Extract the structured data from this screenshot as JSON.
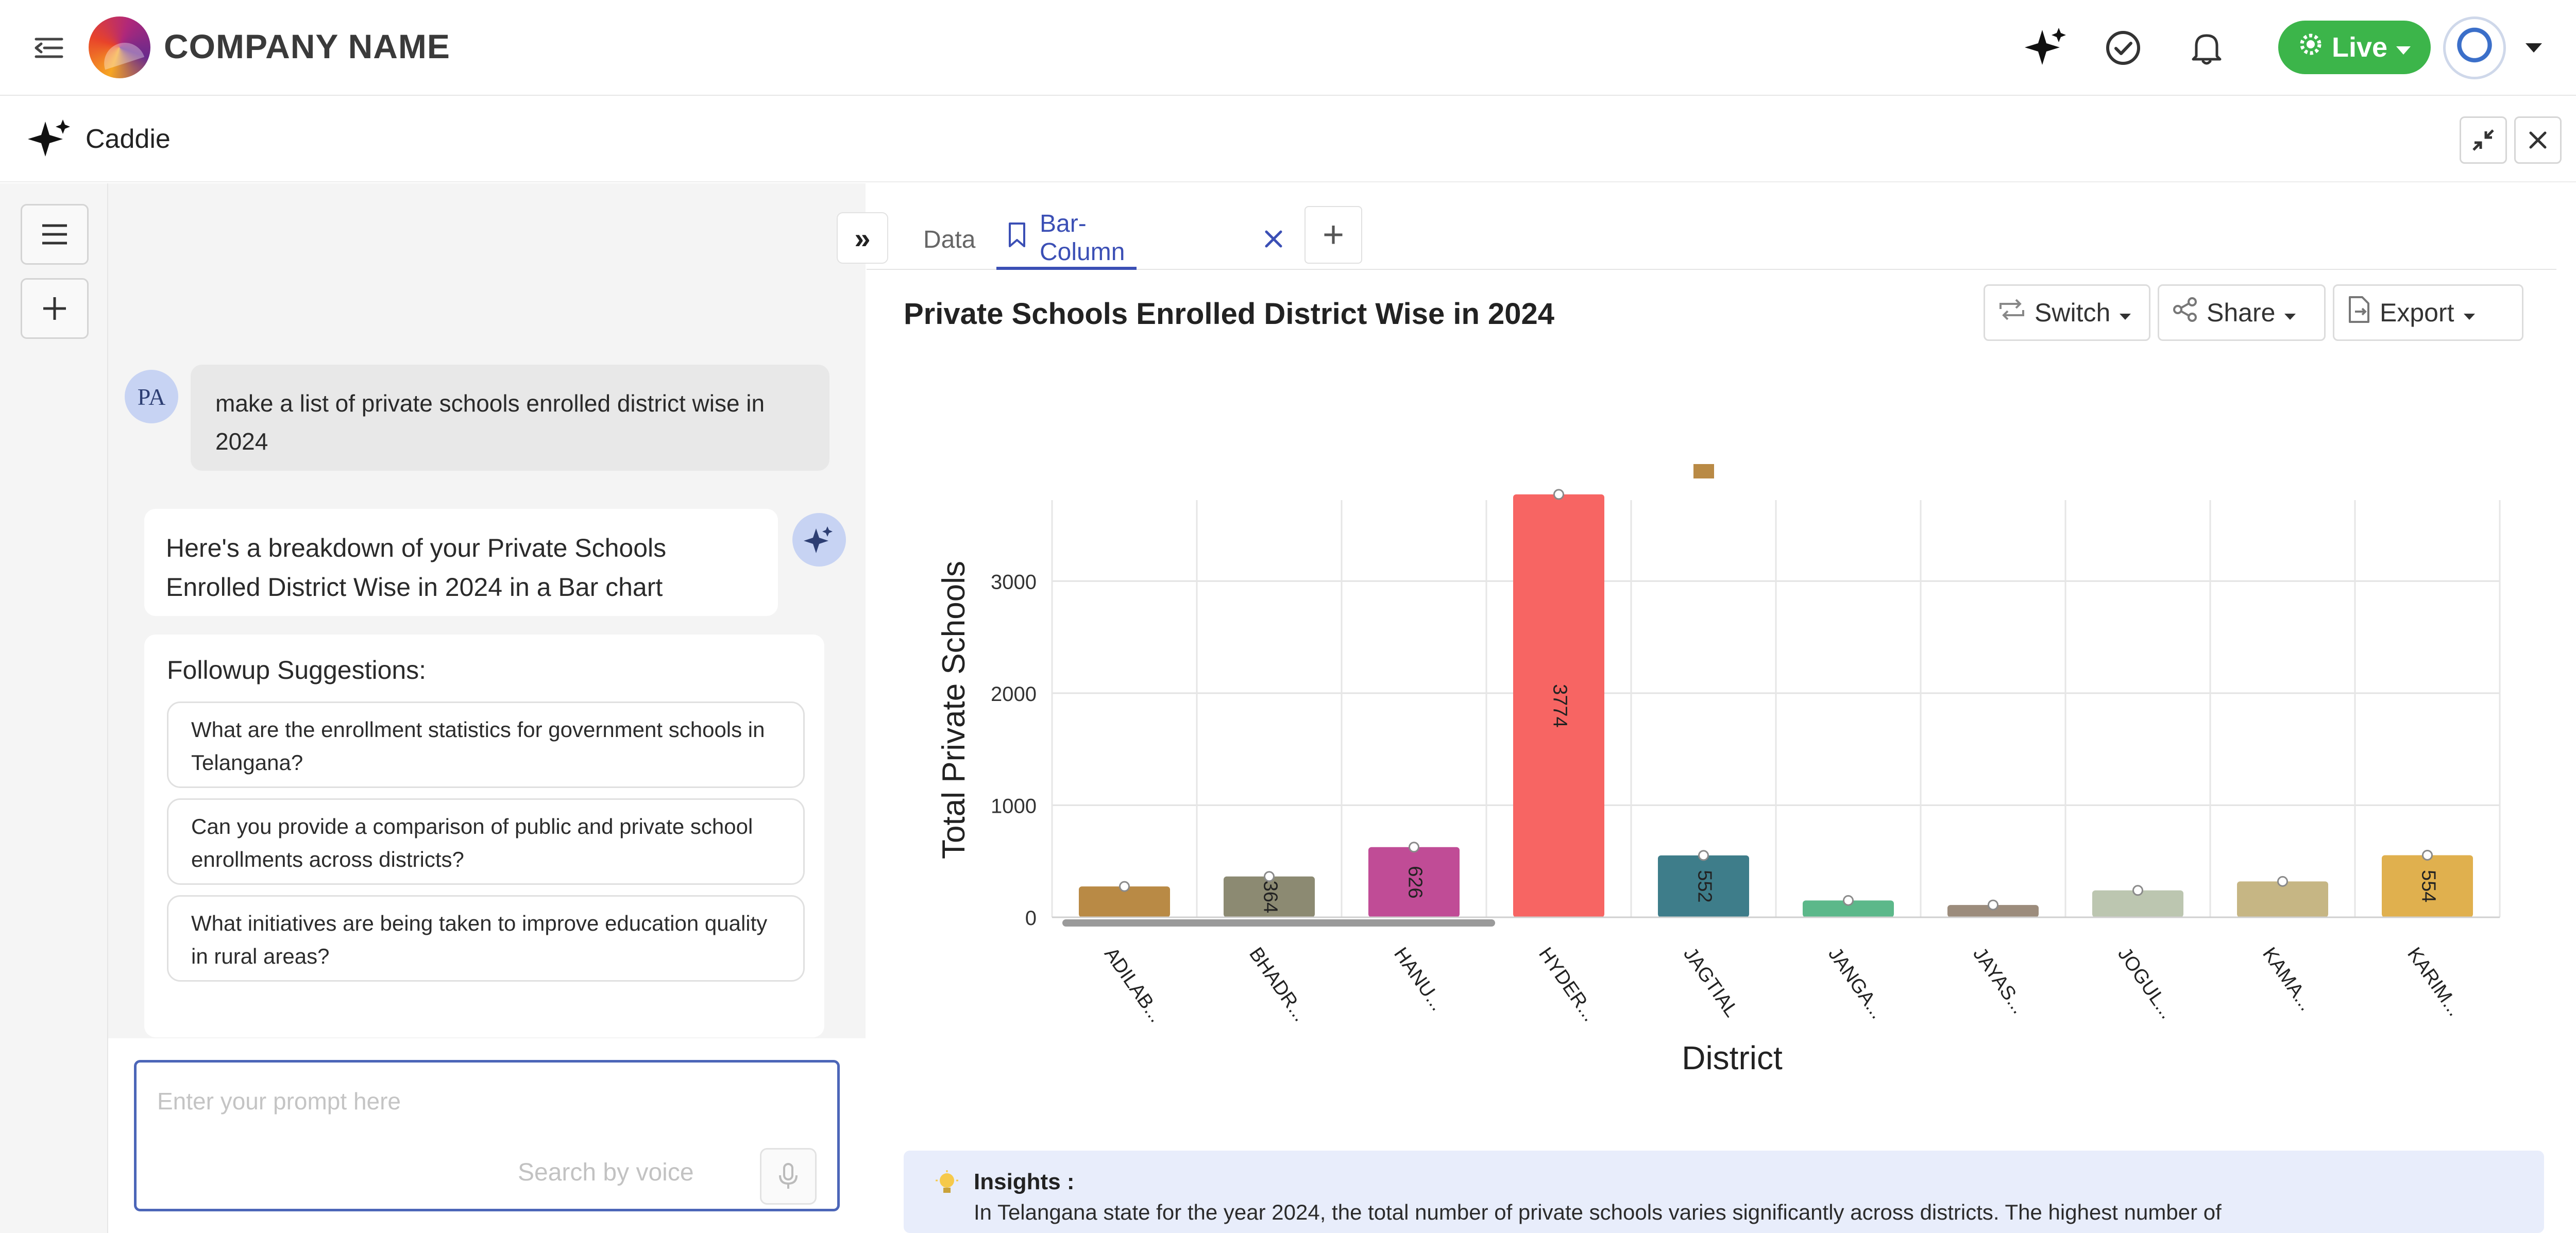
{
  "header": {
    "company_name": "COMPANY NAME",
    "live_label": "Live",
    "icons": [
      "menu-collapse-icon",
      "sparkle-icon",
      "check-circle-icon",
      "bell-icon",
      "gear-icon",
      "user-avatar",
      "caret-down-icon"
    ]
  },
  "caddie": {
    "title": "Caddie",
    "icons": [
      "sparkle-icon",
      "minimize-icon",
      "close-icon"
    ]
  },
  "rail": {
    "icons": [
      "hamburger-icon",
      "plus-icon"
    ]
  },
  "chat": {
    "user_initials": "PA",
    "user_message": "make a list of private schools enrolled district wise in 2024",
    "bot_message": "Here's a breakdown of your Private Schools Enrolled District Wise in 2024 in a Bar chart",
    "followup_title": "Followup Suggestions:",
    "followups": [
      "What are the enrollment statistics for government schools in Telangana?",
      "Can you provide a comparison of public and private school enrollments across districts?",
      "What initiatives are being taken to improve education quality in rural areas?"
    ],
    "prompt_placeholder": "Enter your prompt here",
    "voice_label": "Search by voice"
  },
  "tabs": {
    "data_label": "Data",
    "bar_label": "Bar-Column"
  },
  "toolbar": {
    "switch_label": "Switch",
    "share_label": "Share",
    "export_label": "Export"
  },
  "insights": {
    "title": "Insights :",
    "text": "In Telangana state for the year 2024, the total number of private schools varies significantly across districts. The highest number of"
  },
  "colors": {
    "accent": "#3b4fb5",
    "live": "#3cb54a"
  },
  "chart_data": {
    "type": "bar",
    "title": "Private Schools Enrolled District Wise in 2024",
    "xlabel": "District",
    "ylabel": "Total Private Schools",
    "ylim": [
      0,
      3700
    ],
    "yticks": [
      0,
      1000,
      2000,
      3000
    ],
    "categories": [
      "ADILAB...",
      "BHADR...",
      "HANU...",
      "HYDER...",
      "JAGTIAL",
      "JANGA...",
      "JAYAS...",
      "JOGUL...",
      "KAMA...",
      "KARIM..."
    ],
    "values": [
      275,
      364,
      626,
      3774,
      552,
      150,
      110,
      240,
      320,
      554
    ],
    "data_labels": [
      "",
      "364",
      "626",
      "3774",
      "552",
      "",
      "",
      "",
      "",
      "554"
    ],
    "colors": [
      "#b98a45",
      "#8c8a72",
      "#c04c96",
      "#f76563",
      "#3e7d8a",
      "#5cb88a",
      "#9c8c7c",
      "#bcc6b0",
      "#c6b684",
      "#e0b04e"
    ],
    "grid": true
  }
}
